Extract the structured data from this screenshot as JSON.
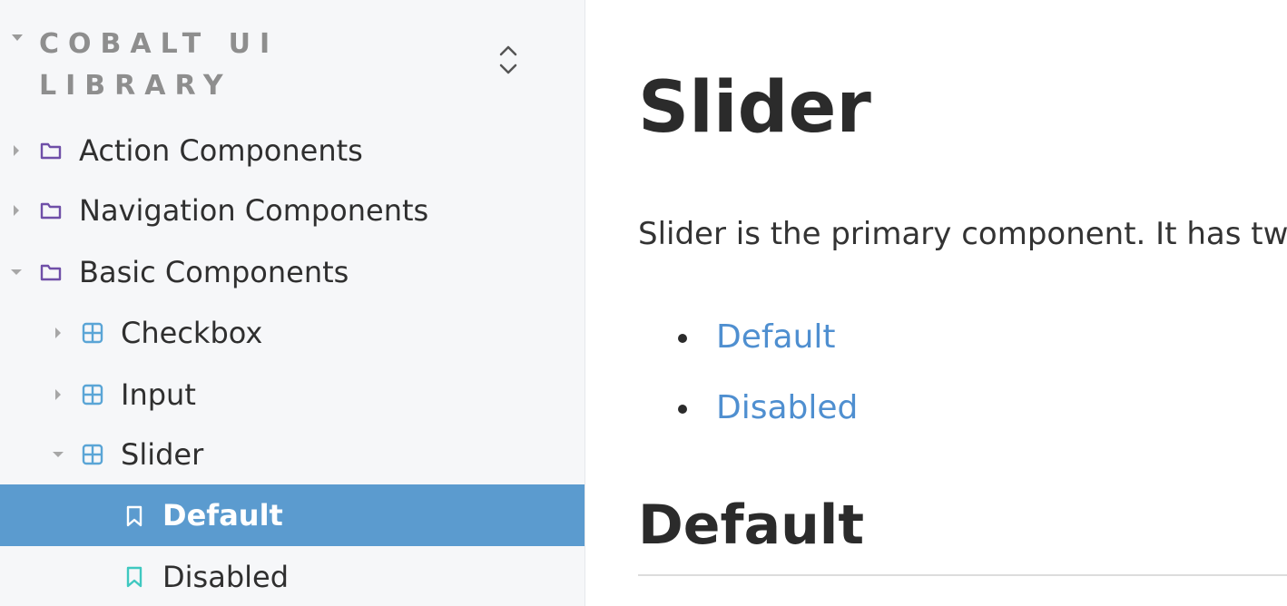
{
  "sidebar": {
    "library_title": "COBALT UI LIBRARY",
    "tree": [
      {
        "label": "Action Components",
        "icon": "folder-icon",
        "expanded": false
      },
      {
        "label": "Navigation Components",
        "icon": "folder-icon",
        "expanded": false
      },
      {
        "label": "Basic Components",
        "icon": "folder-icon",
        "expanded": true
      },
      {
        "label": "Checkbox",
        "icon": "component-icon",
        "expanded": false
      },
      {
        "label": "Input",
        "icon": "component-icon",
        "expanded": false
      },
      {
        "label": "Slider",
        "icon": "component-icon",
        "expanded": true
      },
      {
        "label": "Default",
        "icon": "story-icon",
        "selected": true
      },
      {
        "label": "Disabled",
        "icon": "story-icon",
        "selected": false
      }
    ]
  },
  "main": {
    "title": "Slider",
    "intro": "Slider is the primary component. It has tw",
    "links": [
      "Default",
      "Disabled"
    ],
    "section_title": "Default"
  },
  "colors": {
    "sidebar_bg": "#f6f7f9",
    "selected_bg": "#5b9bcf",
    "folder_icon": "#6f4fa8",
    "component_icon": "#5aa5d6",
    "story_icon": "#3fc8c0",
    "link": "#4f8fd0"
  }
}
